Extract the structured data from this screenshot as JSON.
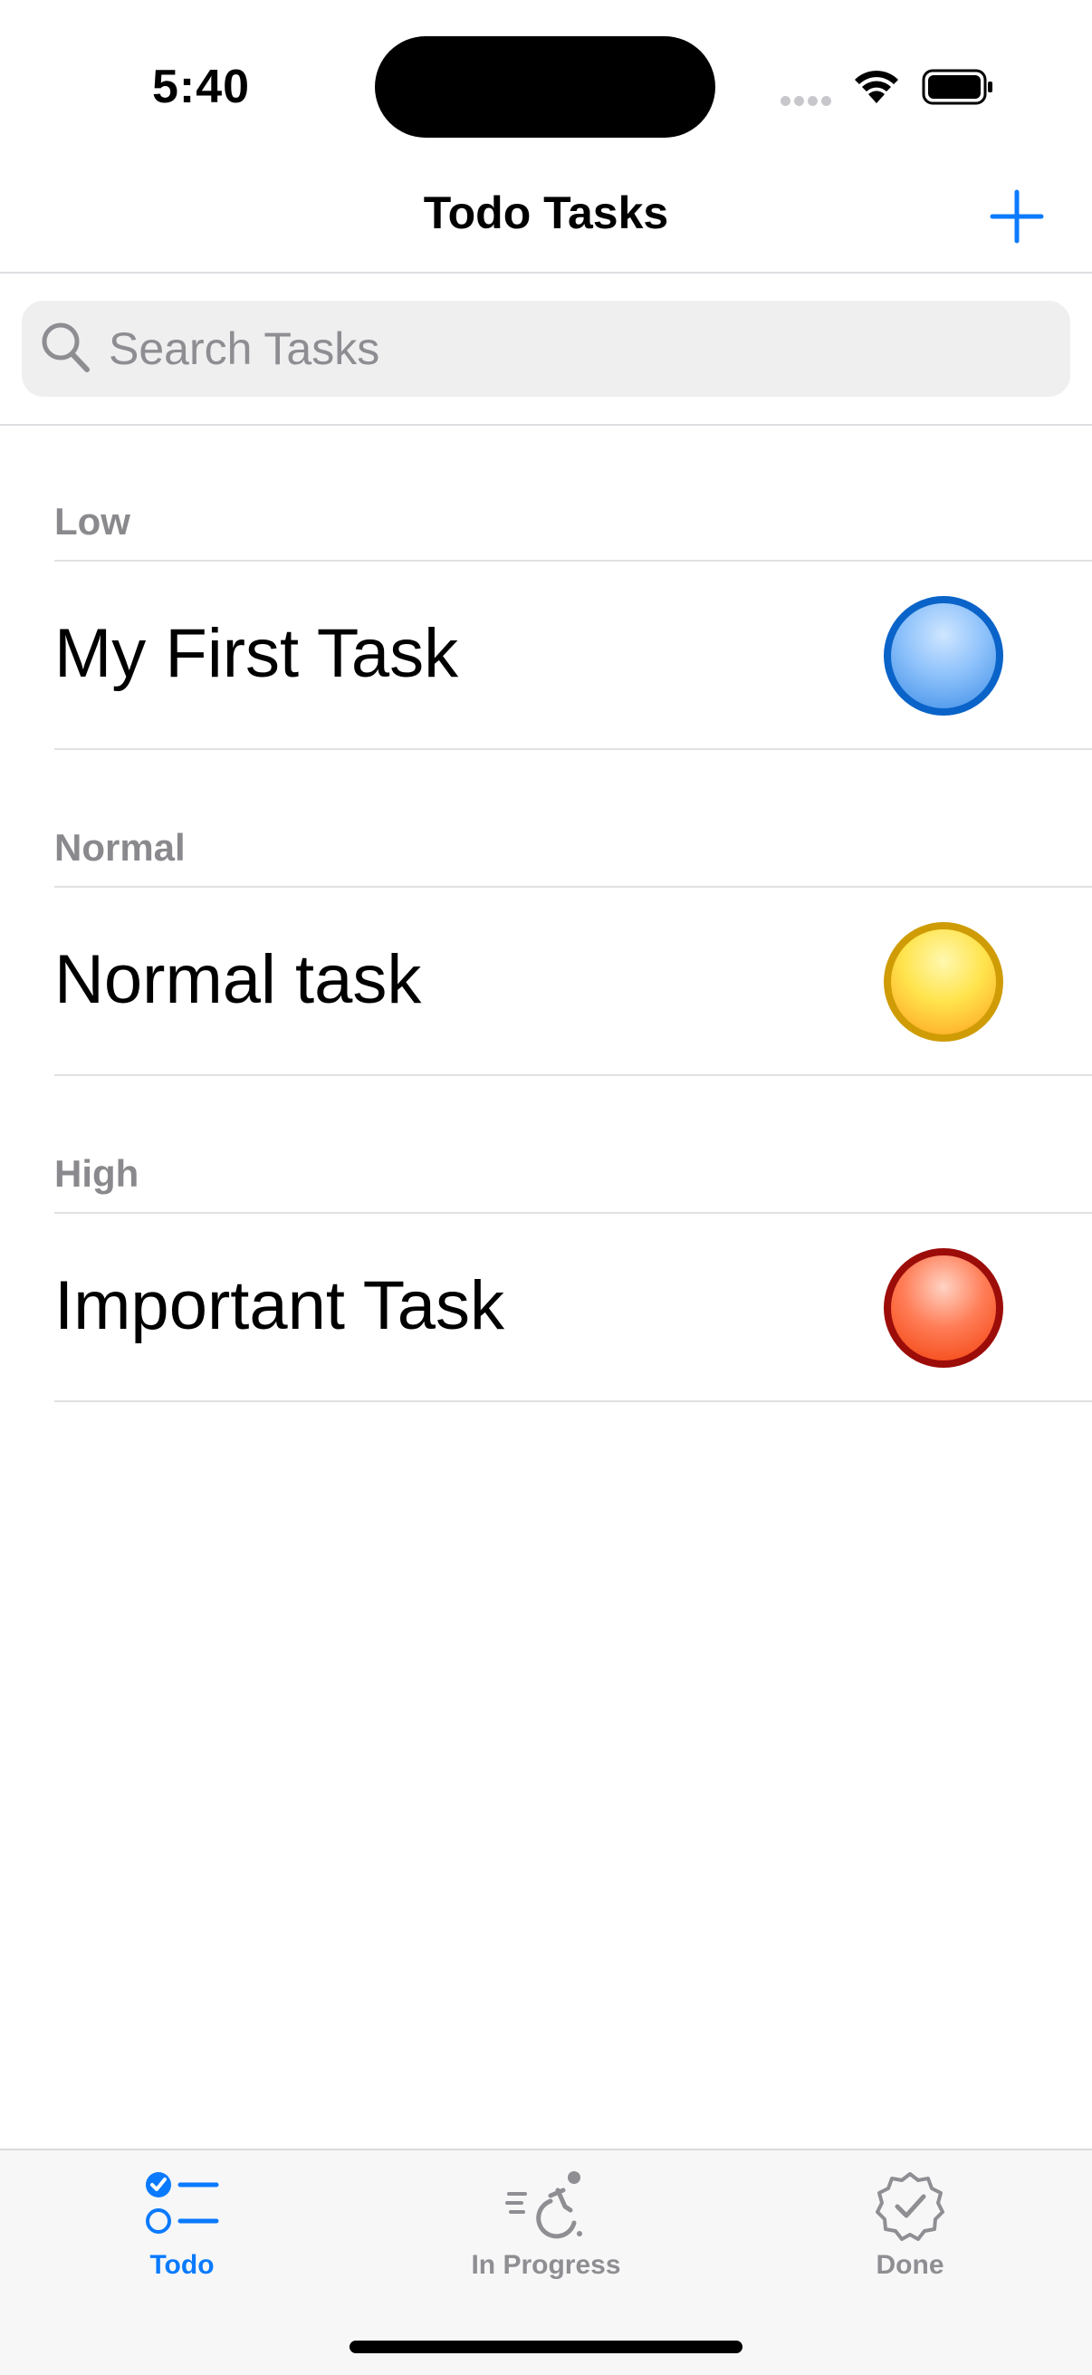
{
  "status_bar": {
    "time": "5:40"
  },
  "nav": {
    "title": "Todo Tasks"
  },
  "search": {
    "placeholder": "Search Tasks",
    "value": ""
  },
  "sections": [
    {
      "header": "Low",
      "task": "My First Task",
      "priority_color": "#0a63c8"
    },
    {
      "header": "Normal",
      "task": "Normal task",
      "priority_color": "#cf9c06"
    },
    {
      "header": "High",
      "task": "Important Task",
      "priority_color": "#9c0d0a"
    }
  ],
  "tabs": [
    {
      "label": "Todo",
      "icon": "checklist-icon",
      "selected": true
    },
    {
      "label": "In Progress",
      "icon": "figure-roll-runningpace-icon",
      "selected": false
    },
    {
      "label": "Done",
      "icon": "checkmark-seal-icon",
      "selected": false
    }
  ],
  "colors": {
    "accent": "#0a7aff",
    "inactive": "#8e8e93"
  }
}
